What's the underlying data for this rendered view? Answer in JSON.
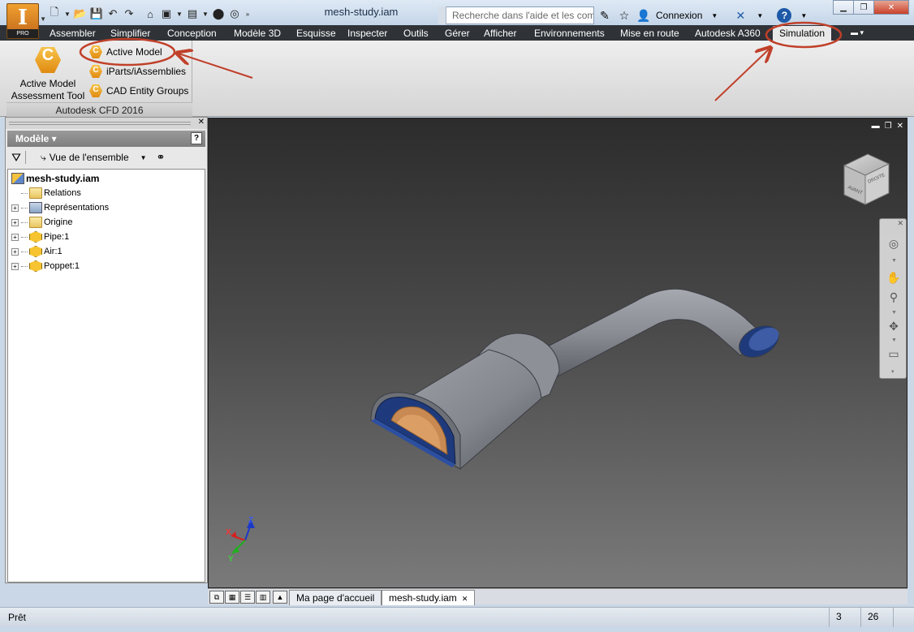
{
  "titlebar": {
    "document_title": "mesh-study.iam",
    "search_placeholder": "Recherche dans l'aide et les com",
    "login_label": "Connexion",
    "app_badge": "PRO",
    "app_letter": "I"
  },
  "ribbon": {
    "tabs": [
      {
        "label": "Assembler"
      },
      {
        "label": "Simplifier"
      },
      {
        "label": "Conception"
      },
      {
        "label": "Modèle 3D"
      },
      {
        "label": "Esquisse"
      },
      {
        "label": "Inspecter"
      },
      {
        "label": "Outils"
      },
      {
        "label": "Gérer"
      },
      {
        "label": "Afficher"
      },
      {
        "label": "Environnements"
      },
      {
        "label": "Mise en route"
      },
      {
        "label": "Autodesk A360"
      },
      {
        "label": "Simulation"
      }
    ],
    "panel": {
      "title": "Autodesk CFD 2016",
      "big_button_line1": "Active Model",
      "big_button_line2": "Assessment Tool",
      "small_buttons": [
        "Active Model",
        "iParts/iAssemblies",
        "CAD Entity Groups"
      ]
    }
  },
  "browser": {
    "header": "Modèle ▾",
    "view_label": "Vue de l'ensemble",
    "tree": [
      {
        "label": "mesh-study.iam",
        "icon": "assembly-icon",
        "expandable": false,
        "root": true
      },
      {
        "label": "Relations",
        "icon": "folder-icon",
        "expandable": false
      },
      {
        "label": "Représentations",
        "icon": "representations-icon",
        "expandable": true
      },
      {
        "label": "Origine",
        "icon": "folder-icon",
        "expandable": true
      },
      {
        "label": "Pipe:1",
        "icon": "part-icon",
        "expandable": true
      },
      {
        "label": "Air:1",
        "icon": "part-icon",
        "expandable": true
      },
      {
        "label": "Poppet:1",
        "icon": "part-icon",
        "expandable": true
      }
    ]
  },
  "viewcube": {
    "front": "AVANT",
    "right": "DROITE"
  },
  "axes": {
    "x": "X",
    "y": "Y",
    "z": "Z"
  },
  "doc_tabs": [
    {
      "label": "Ma page d'accueil",
      "active": false
    },
    {
      "label": "mesh-study.iam",
      "active": true
    }
  ],
  "status": {
    "text": "Prêt",
    "count1": "3",
    "count2": "26"
  },
  "colors": {
    "annotation": "#c0402a",
    "tabbar": "#2f3338",
    "model": "#8a8d94"
  }
}
